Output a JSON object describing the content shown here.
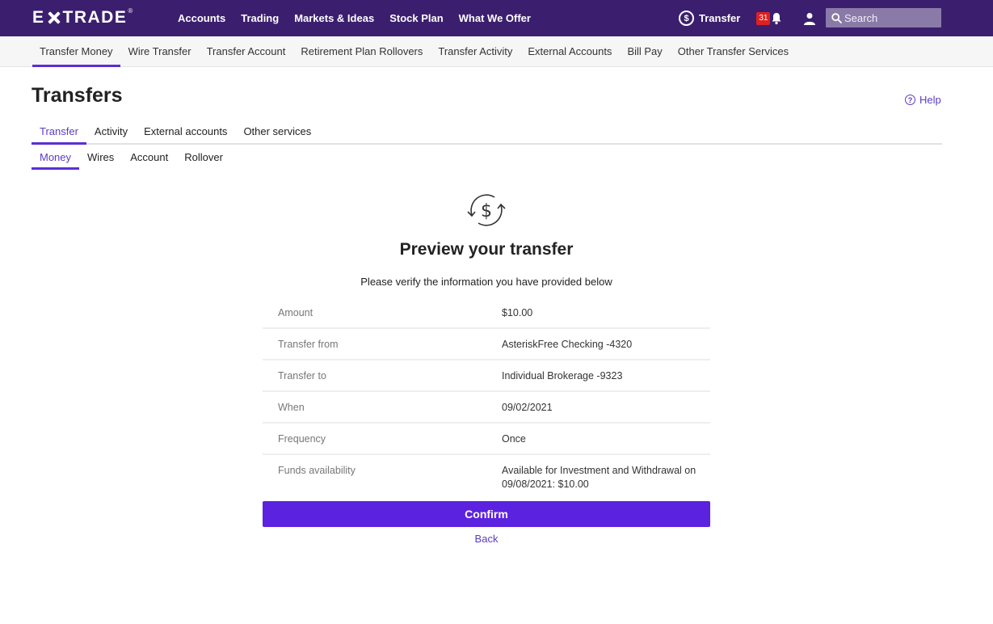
{
  "header": {
    "logo_left": "E",
    "logo_right": "TRADE",
    "logo_reg": "®",
    "nav": [
      "Accounts",
      "Trading",
      "Markets & Ideas",
      "Stock Plan",
      "What We Offer"
    ],
    "transfer_label": "Transfer",
    "transfer_icon": "dollar-circle-icon",
    "notification_count": "31",
    "search_placeholder": "Search"
  },
  "subnav": {
    "items": [
      "Transfer Money",
      "Wire Transfer",
      "Transfer Account",
      "Retirement Plan Rollovers",
      "Transfer Activity",
      "External Accounts",
      "Bill Pay",
      "Other Transfer Services"
    ],
    "active_index": 0
  },
  "page": {
    "title": "Transfers",
    "help_label": "Help",
    "tabs": [
      "Transfer",
      "Activity",
      "External accounts",
      "Other services"
    ],
    "subtabs": [
      "Money",
      "Wires",
      "Account",
      "Rollover"
    ]
  },
  "preview": {
    "title": "Preview your transfer",
    "subtitle": "Please verify the information you have provided below",
    "rows": [
      {
        "label": "Amount",
        "value": "$10.00"
      },
      {
        "label": "Transfer from",
        "value": "AsteriskFree Checking -4320"
      },
      {
        "label": "Transfer to",
        "value": "Individual Brokerage -9323"
      },
      {
        "label": "When",
        "value": "09/02/2021"
      },
      {
        "label": "Frequency",
        "value": "Once"
      },
      {
        "label": "Funds availability",
        "value": "Available for Investment and Withdrawal on 09/08/2021: $10.00"
      }
    ],
    "confirm_label": "Confirm",
    "back_label": "Back"
  },
  "colors": {
    "header_bg": "#3b1f6e",
    "accent": "#5b2ed4",
    "confirm_bg": "#5b22e0",
    "badge": "#e02020"
  }
}
